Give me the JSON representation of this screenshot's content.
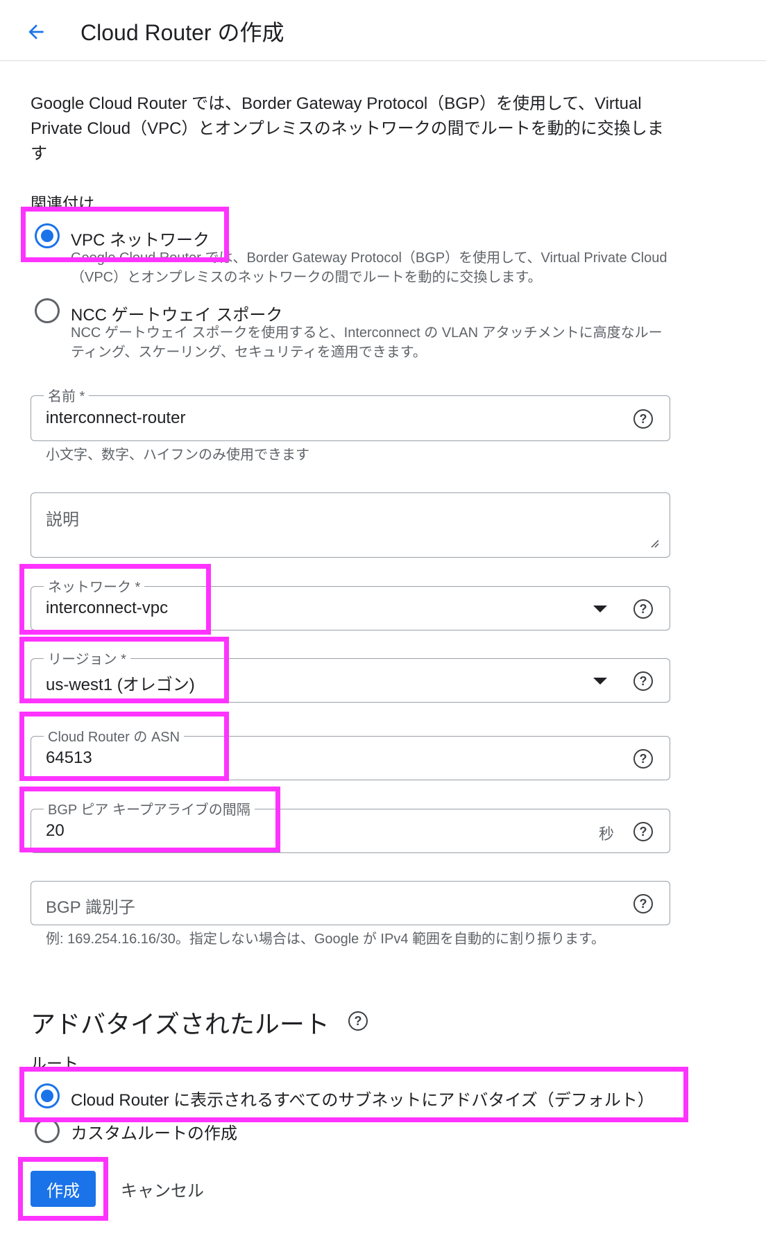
{
  "header": {
    "title": "Cloud Router の作成"
  },
  "intro": "Google Cloud Router では、Border Gateway Protocol（BGP）を使用して、Virtual Private Cloud（VPC）とオンプレミスのネットワークの間でルートを動的に交換します",
  "association": {
    "label": "関連付け",
    "options": [
      {
        "title": "VPC ネットワーク",
        "desc": "Google Cloud Router では、Border Gateway Protocol（BGP）を使用して、Virtual Private Cloud（VPC）とオンプレミスのネットワークの間でルートを動的に交換します。",
        "selected": true
      },
      {
        "title": "NCC ゲートウェイ スポーク",
        "desc": "NCC ゲートウェイ スポークを使用すると、Interconnect の VLAN アタッチメントに高度なルーティング、スケーリング、セキュリティを適用できます。",
        "selected": false
      }
    ]
  },
  "fields": {
    "name": {
      "label": "名前 *",
      "value": "interconnect-router",
      "hint": "小文字、数字、ハイフンのみ使用できます"
    },
    "description": {
      "placeholder": "説明"
    },
    "network": {
      "label": "ネットワーク *",
      "value": "interconnect-vpc"
    },
    "region": {
      "label": "リージョン *",
      "value": "us-west1 (オレゴン)"
    },
    "asn": {
      "label": "Cloud Router の ASN",
      "value": "64513"
    },
    "keepalive": {
      "label": "BGP ピア キープアライブの間隔",
      "value": "20",
      "suffix": "秒"
    },
    "bgp_id": {
      "placeholder": "BGP 識別子",
      "hint": "例: 169.254.16.16/30。指定しない場合は、Google が IPv4 範囲を自動的に割り振ります。"
    }
  },
  "advertised": {
    "heading": "アドバタイズされたルート",
    "routes_label": "ルート",
    "options": [
      {
        "title": "Cloud Router に表示されるすべてのサブネットにアドバタイズ（デフォルト）",
        "selected": true
      },
      {
        "title": "カスタムルートの作成",
        "selected": false
      }
    ]
  },
  "actions": {
    "create": "作成",
    "cancel": "キャンセル"
  },
  "icons": {
    "back": "arrow-back-icon",
    "help": "help-circle-icon",
    "dropdown": "dropdown-caret-icon",
    "resize": "resize-handle-icon"
  },
  "colors": {
    "accent": "#1a73e8",
    "highlight": "#ff33ff"
  }
}
